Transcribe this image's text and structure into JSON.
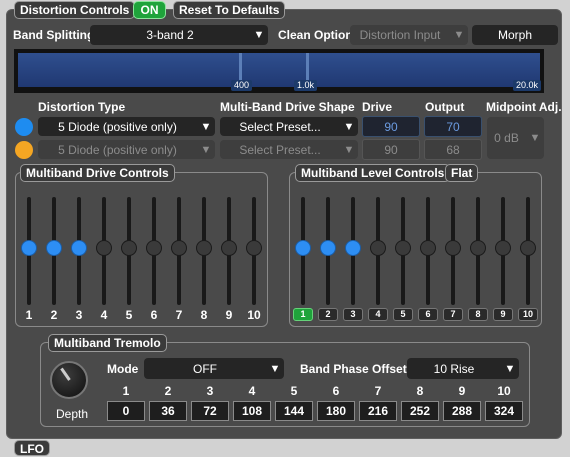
{
  "header": {
    "title": "Distortion Controls",
    "toggle_label": "ON",
    "reset_label": "Reset To Defaults"
  },
  "band_splitting": {
    "label": "Band Splitting",
    "value": "3-band 2",
    "clean_label": "Clean Option",
    "clean_value": "Distortion Input",
    "morph_label": "Morph",
    "spectrum_markers": [
      "400",
      "1.0k",
      "20.0k"
    ]
  },
  "columns": {
    "type": "Distortion Type",
    "shape": "Multi-Band Drive Shape",
    "drive": "Drive",
    "output": "Output",
    "midpoint": "Midpoint Adj."
  },
  "rows": [
    {
      "color": "#1e8cf0",
      "type": "5 Diode (positive only)",
      "shape": "Select Preset...",
      "drive": "90",
      "output": "70",
      "enabled": true
    },
    {
      "color": "#f5a623",
      "type": "5 Diode (positive only)",
      "shape": "Select Preset...",
      "drive": "90",
      "output": "68",
      "enabled": false
    }
  ],
  "midpoint_value": "0 dB",
  "drive_panel": {
    "title": "Multiband Drive Controls",
    "labels": [
      "1",
      "2",
      "3",
      "4",
      "5",
      "6",
      "7",
      "8",
      "9",
      "10"
    ],
    "active": [
      true,
      true,
      true,
      false,
      false,
      false,
      false,
      false,
      false,
      false
    ]
  },
  "level_panel": {
    "title": "Multiband Level Controls",
    "flat_label": "Flat",
    "labels": [
      "1",
      "2",
      "3",
      "4",
      "5",
      "6",
      "7",
      "8",
      "9",
      "10"
    ],
    "active": [
      true,
      true,
      true,
      false,
      false,
      false,
      false,
      false,
      false,
      false
    ],
    "selected_band": "1"
  },
  "tremolo": {
    "title": "Multiband Tremolo",
    "depth_label": "Depth",
    "mode_label": "Mode",
    "mode_value": "OFF",
    "phase_label": "Band Phase Offsets",
    "phase_value": "10 Rise",
    "band_numbers": [
      "1",
      "2",
      "3",
      "4",
      "5",
      "6",
      "7",
      "8",
      "9",
      "10"
    ],
    "offsets": [
      "0",
      "36",
      "72",
      "108",
      "144",
      "180",
      "216",
      "252",
      "288",
      "324"
    ]
  },
  "footer_tab": "LFO",
  "colors": {
    "accent_blue": "#2d8ef4",
    "on_green": "#1fa33b",
    "orange": "#f5a623"
  }
}
